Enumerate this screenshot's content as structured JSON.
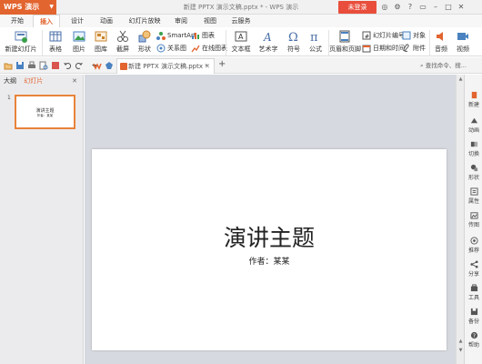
{
  "app": {
    "name": "WPS 演示",
    "window_title": "新建 PPTX 演示文稿.pptx * - WPS 演示",
    "login_label": "未登录"
  },
  "tabs": [
    "开始",
    "插入",
    "设计",
    "动画",
    "幻灯片放映",
    "审阅",
    "视图",
    "云服务"
  ],
  "active_tab": "插入",
  "ribbon": {
    "new_slide": "新建幻灯片",
    "table": "表格",
    "picture": "图片",
    "gallery": "图库",
    "screenshot": "截屏",
    "shape": "形状",
    "smartart": "SmartArt",
    "chart": "图表",
    "relation": "关系图",
    "online_chart": "在线图表",
    "textbox": "文本框",
    "wordart": "艺术字",
    "symbol": "符号",
    "formula": "公式",
    "header_footer": "页眉和页脚",
    "slide_number": "幻灯片编号",
    "object": "对象",
    "datetime": "日期和时间",
    "attachment": "附件",
    "audio": "音频",
    "video": "视频"
  },
  "document_tab": "新建 PPTX 演示文稿.pptx *",
  "search_placeholder": "查找命令、搜...",
  "left_panel": {
    "tab_outline": "大纲",
    "tab_slides": "幻灯片",
    "slide_number": "1"
  },
  "slide": {
    "title": "演讲主题",
    "subtitle": "作者：某某"
  },
  "thumb": {
    "title": "演讲主题",
    "subtitle": "作者：某某"
  },
  "right_sidebar": [
    "新建",
    "动画",
    "切换",
    "形状",
    "属性",
    "传图",
    "推荐",
    "分享",
    "工具",
    "备份",
    "帮助"
  ],
  "colors": {
    "accent": "#e2642f",
    "login": "#e94e3c",
    "canvas_bg": "#d6d9df"
  }
}
